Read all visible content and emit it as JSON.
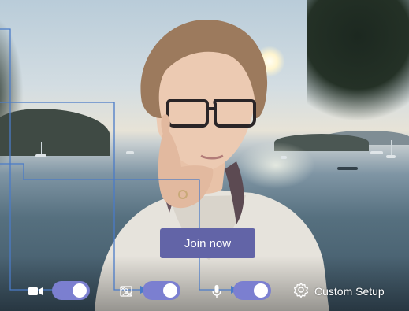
{
  "join": {
    "label": "Join now"
  },
  "controls": {
    "camera": {
      "icon": "camera-icon",
      "state": "on"
    },
    "background_effects": {
      "icon": "background-effects-icon",
      "state": "on"
    },
    "microphone": {
      "icon": "microphone-icon",
      "state": "on"
    },
    "custom_setup": {
      "icon": "gear-icon",
      "label": "Custom Setup"
    }
  },
  "colors": {
    "accent": "#6264a7",
    "toggle_on": "#7b7fd0",
    "callout_line": "#4a7bc8"
  }
}
